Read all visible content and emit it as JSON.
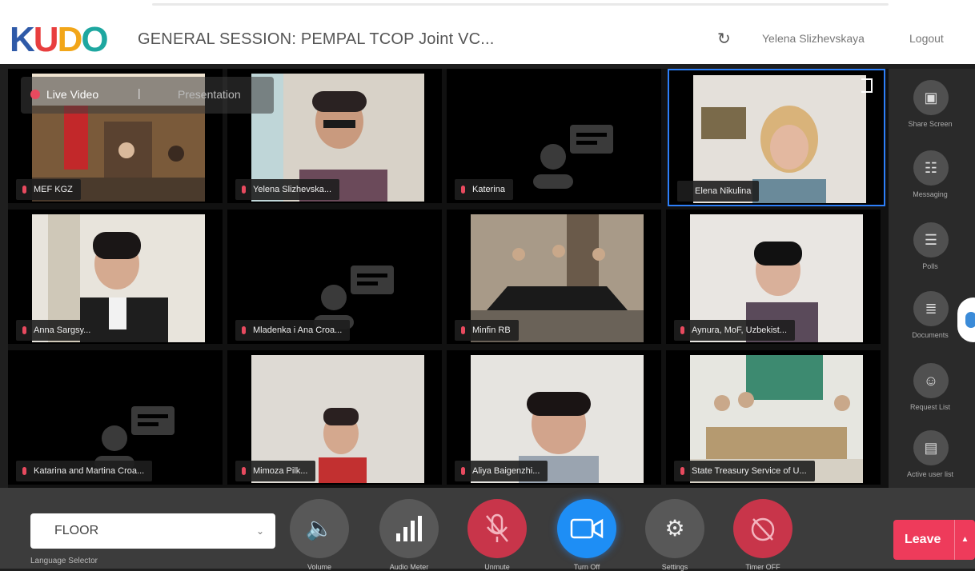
{
  "header": {
    "logo": {
      "k": "K",
      "u": "U",
      "d": "D",
      "o": "O"
    },
    "session_title": "GENERAL SESSION: PEMPAL TCOP Joint VC...",
    "refresh_icon": "refresh-icon",
    "user_name": "Yelena Slizhevskaya",
    "logout_label": "Logout"
  },
  "stage": {
    "live_video_label": "Live Video",
    "separator": "|",
    "presentation_label": "Presentation",
    "tiles": [
      {
        "name": "MEF KGZ"
      },
      {
        "name": "Yelena Slizhevska..."
      },
      {
        "name": "Katerina"
      },
      {
        "name": "Elena Nikulina"
      },
      {
        "name": "Anna Sargsy..."
      },
      {
        "name": "Mladenka i Ana Croa..."
      },
      {
        "name": "Minfin RB"
      },
      {
        "name": "Aynura, MoF, Uzbekist..."
      },
      {
        "name": "Katarina and Martina Croa..."
      },
      {
        "name": "Mimoza Pilk..."
      },
      {
        "name": "Aliya Baigenzhi..."
      },
      {
        "name": "State Treasury Service of U..."
      }
    ]
  },
  "rail": {
    "items": [
      {
        "label": "Share Screen",
        "icon": "share-screen-icon"
      },
      {
        "label": "Messaging",
        "icon": "messaging-icon"
      },
      {
        "label": "Polls",
        "icon": "polls-icon"
      },
      {
        "label": "Documents",
        "icon": "documents-icon"
      },
      {
        "label": "Request List",
        "icon": "request-list-icon"
      },
      {
        "label": "Active user list",
        "icon": "active-user-list-icon"
      }
    ]
  },
  "bottom": {
    "language_value": "FLOOR",
    "language_caption": "Language Selector",
    "controls": [
      {
        "label": "Volume",
        "icon": "volume-icon"
      },
      {
        "label": "Audio Meter",
        "icon": "audio-meter-icon"
      },
      {
        "label": "Unmute",
        "icon": "mic-muted-icon"
      },
      {
        "label": "Turn Off",
        "icon": "video-camera-icon"
      },
      {
        "label": "Settings",
        "icon": "gear-icon"
      },
      {
        "label": "Timer OFF",
        "icon": "timer-off-icon"
      }
    ],
    "leave_label": "Leave"
  },
  "colors": {
    "accent_blue": "#1e8ef5",
    "alert_red": "#c8354a",
    "leave_red": "#ee3b5b",
    "active_tile_border": "#2d7ff9"
  }
}
